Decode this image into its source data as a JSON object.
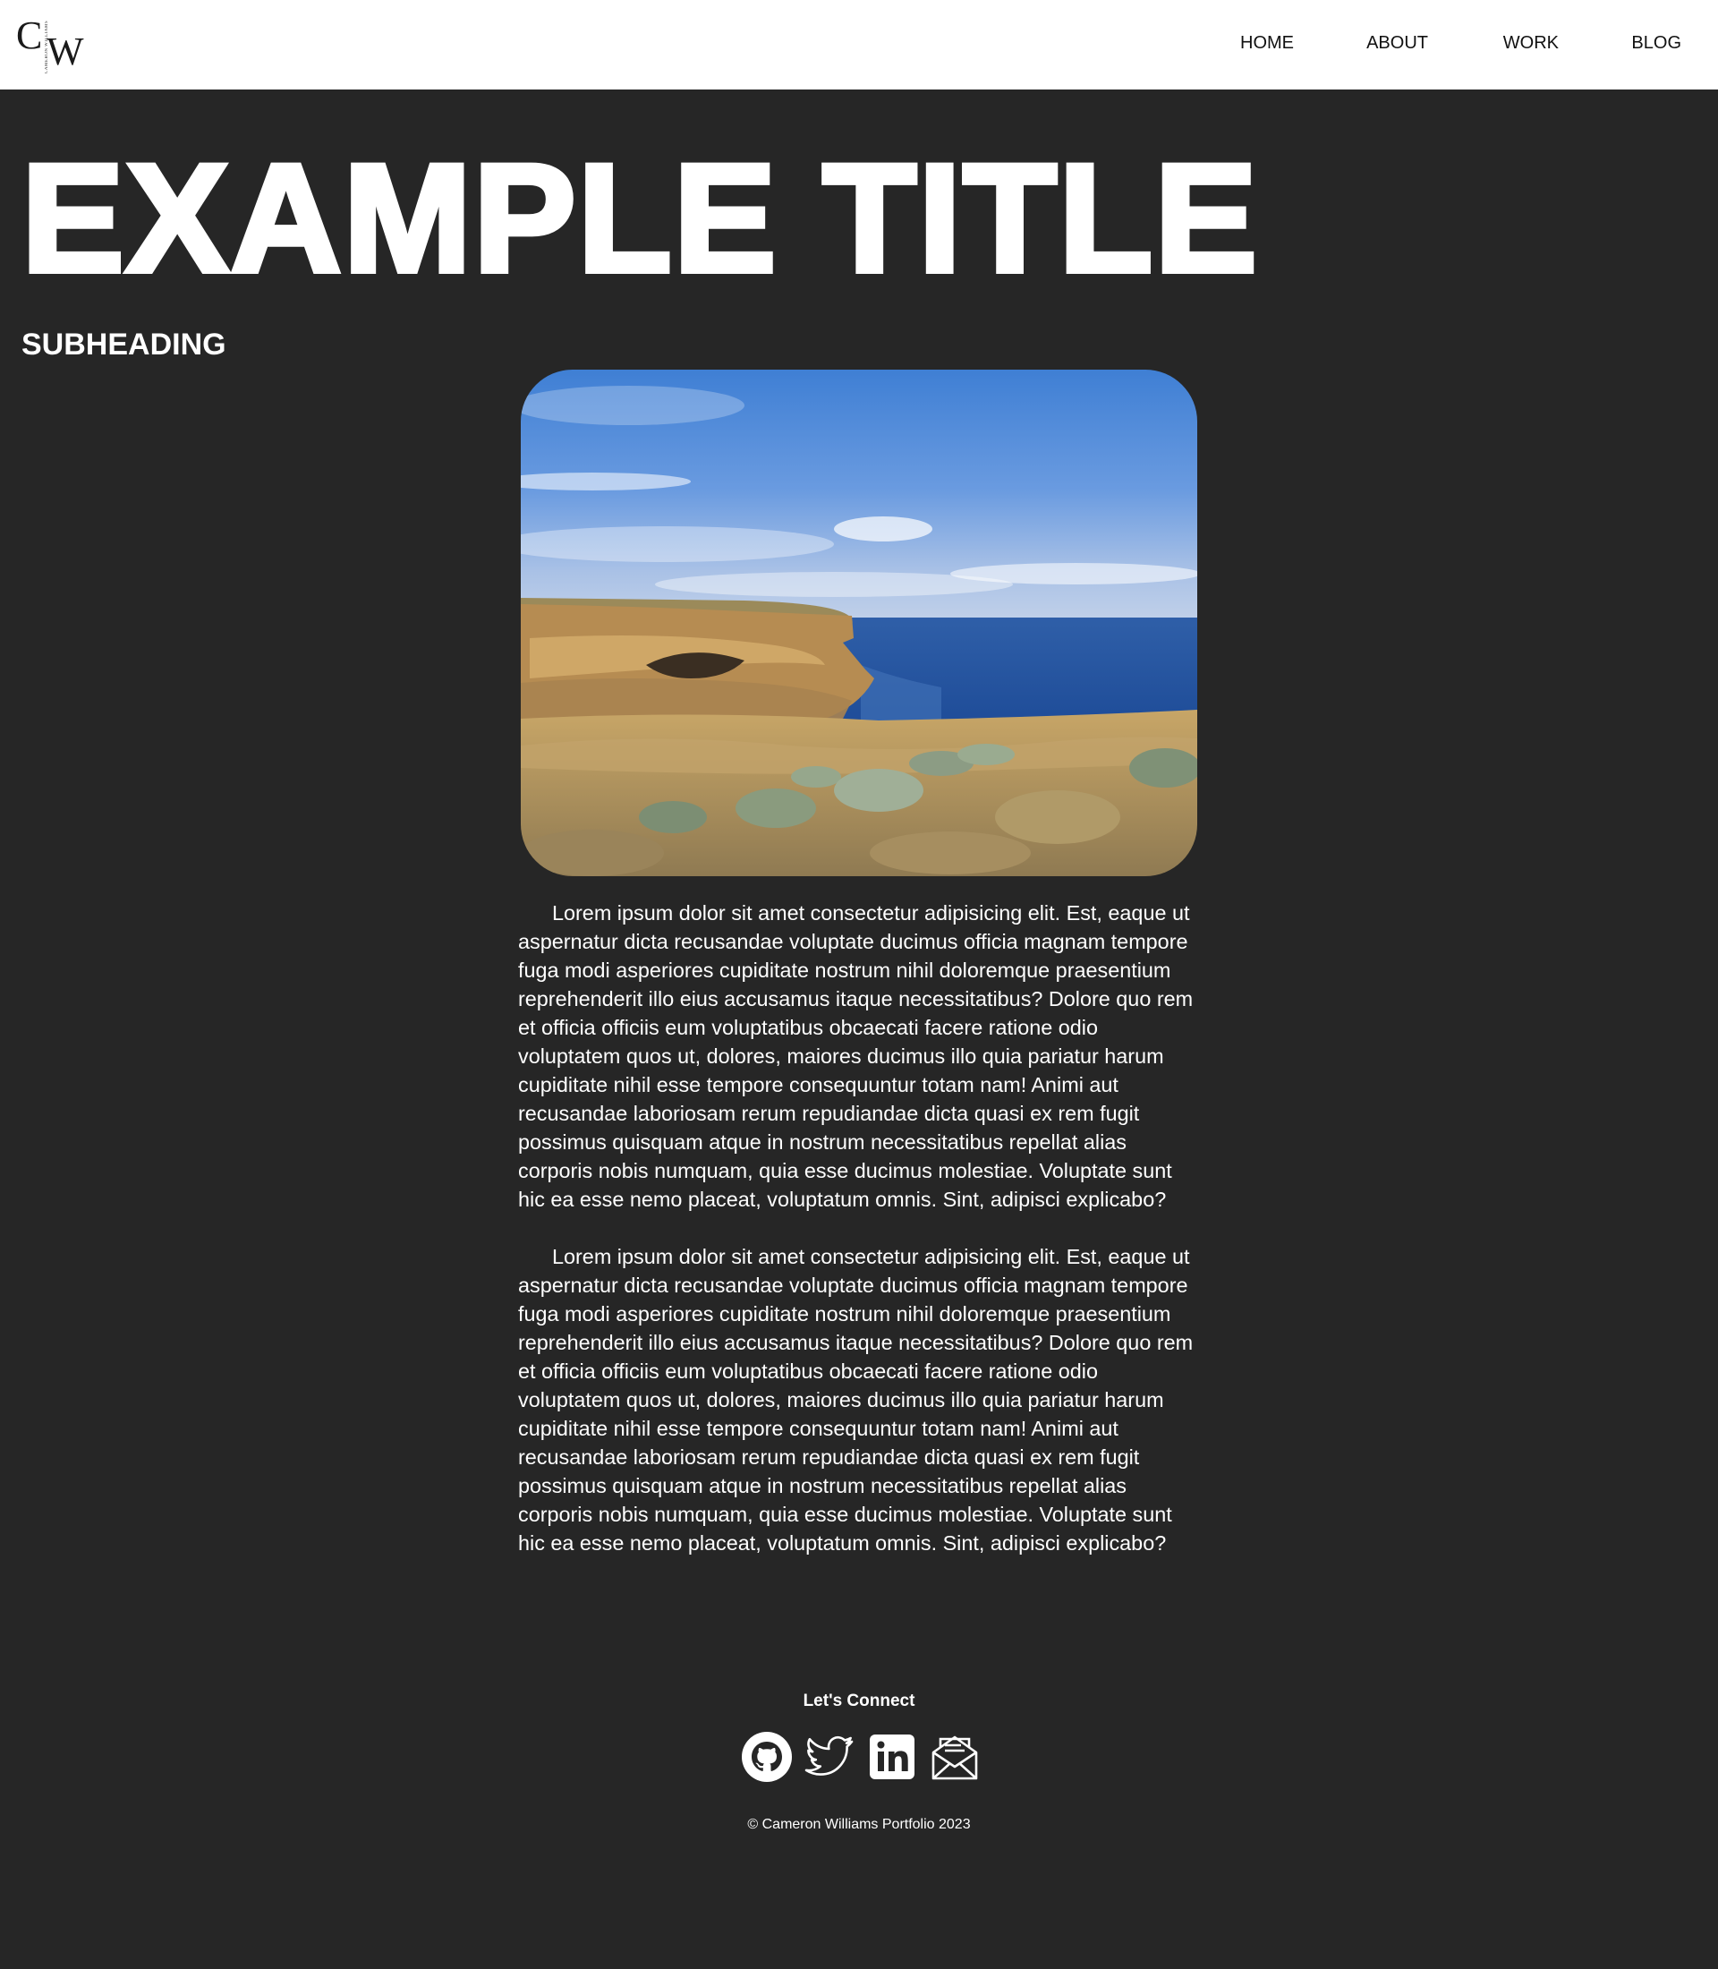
{
  "header": {
    "logo": {
      "letters": "CW",
      "small_text": "CAMERON WILLIAMS"
    },
    "nav": [
      {
        "label": "HOME"
      },
      {
        "label": "ABOUT"
      },
      {
        "label": "WORK"
      },
      {
        "label": "BLOG"
      }
    ]
  },
  "hero": {
    "title": "EXAMPLE TITLE",
    "subheading": "SUBHEADING"
  },
  "article": {
    "paragraphs": [
      "Lorem ipsum dolor sit amet consectetur adipisicing elit. Est, eaque ut aspernatur dicta recusandae voluptate ducimus officia magnam tempore fuga modi asperiores cupiditate nostrum nihil doloremque praesentium reprehenderit illo eius accusamus itaque necessitatibus? Dolore quo rem et officia officiis eum voluptatibus obcaecati facere ratione odio voluptatem quos ut, dolores, maiores ducimus illo quia pariatur harum cupiditate nihil esse tempore consequuntur totam nam! Animi aut recusandae laboriosam rerum repudiandae dicta quasi ex rem fugit possimus quisquam atque in nostrum necessitatibus repellat alias corporis nobis numquam, quia esse ducimus molestiae. Voluptate sunt hic ea esse nemo placeat, voluptatum omnis. Sint, adipisci explicabo?",
      "Lorem ipsum dolor sit amet consectetur adipisicing elit. Est, eaque ut aspernatur dicta recusandae voluptate ducimus officia magnam tempore fuga modi asperiores cupiditate nostrum nihil doloremque praesentium reprehenderit illo eius accusamus itaque necessitatibus? Dolore quo rem et officia officiis eum voluptatibus obcaecati facere ratione odio voluptatem quos ut, dolores, maiores ducimus illo quia pariatur harum cupiditate nihil esse tempore consequuntur totam nam! Animi aut recusandae laboriosam rerum repudiandae dicta quasi ex rem fugit possimus quisquam atque in nostrum necessitatibus repellat alias corporis nobis numquam, quia esse ducimus molestiae. Voluptate sunt hic ea esse nemo placeat, voluptatum omnis. Sint, adipisci explicabo?"
    ]
  },
  "footer": {
    "heading": "Let's Connect",
    "socials": [
      {
        "icon": "github-icon"
      },
      {
        "icon": "twitter-icon"
      },
      {
        "icon": "linkedin-icon"
      },
      {
        "icon": "email-icon"
      }
    ],
    "copyright": "© Cameron Williams Portfolio 2023"
  },
  "colors": {
    "page_background": "#262626",
    "header_background": "#ffffff",
    "text": "#ffffff",
    "nav_text": "#111111"
  }
}
